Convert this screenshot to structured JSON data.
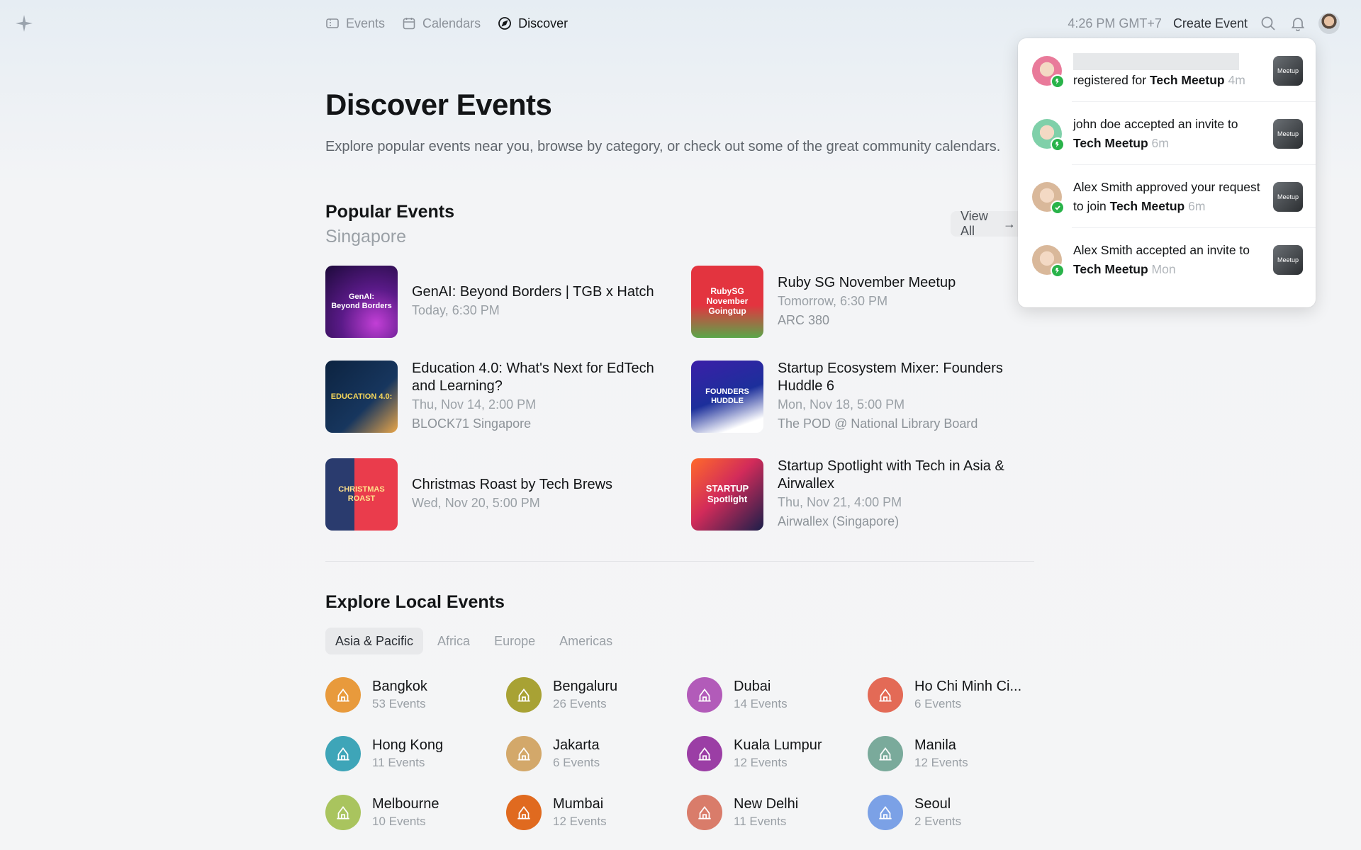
{
  "nav": {
    "items": [
      {
        "label": "Events",
        "icon": "ticket-icon",
        "active": false
      },
      {
        "label": "Calendars",
        "icon": "calendar-icon",
        "active": false
      },
      {
        "label": "Discover",
        "icon": "compass-icon",
        "active": true
      }
    ],
    "time": "4:26 PM GMT+7",
    "create_event": "Create Event"
  },
  "page": {
    "title": "Discover Events",
    "subtitle": "Explore popular events near you, browse by category, or check out some of the great community calendars."
  },
  "popular": {
    "title": "Popular Events",
    "location": "Singapore",
    "view_all": "View All",
    "events": [
      {
        "title": "GenAI: Beyond Borders | TGB x Hatch",
        "title2": "",
        "date": "Today, 6:30 PM",
        "venue": "",
        "thumb_text": "GenAI:\nBeyond Borders"
      },
      {
        "title": "Ruby SG November Meetup",
        "title2": "",
        "date": "Tomorrow, 6:30 PM",
        "venue": "ARC 380",
        "thumb_text": "RubySG November Goingtup"
      },
      {
        "title": "Education 4.0: What's Next for EdTech",
        "title2": "and Learning?",
        "date": "Thu, Nov 14, 2:00 PM",
        "venue": "BLOCK71 Singapore",
        "thumb_text": "EDUCATION 4.0:"
      },
      {
        "title": "Startup Ecosystem Mixer: Founders",
        "title2": "Huddle 6",
        "date": "Mon, Nov 18, 5:00 PM",
        "venue": "The POD @ National Library Board",
        "thumb_text": "FOUNDERS HUDDLE"
      },
      {
        "title": "Christmas Roast by Tech Brews",
        "title2": "",
        "date": "Wed, Nov 20, 5:00 PM",
        "venue": "",
        "thumb_text": "CHRISTMAS ROAST"
      },
      {
        "title": "Startup Spotlight with Tech in Asia &",
        "title2": "Airwallex",
        "date": "Thu, Nov 21, 4:00 PM",
        "venue": "Airwallex (Singapore)",
        "thumb_text": "STARTUP Spotlight"
      }
    ]
  },
  "local": {
    "title": "Explore Local Events",
    "tabs": [
      {
        "label": "Asia & Pacific",
        "active": true
      },
      {
        "label": "Africa",
        "active": false
      },
      {
        "label": "Europe",
        "active": false
      },
      {
        "label": "Americas",
        "active": false
      }
    ],
    "cities": [
      {
        "name": "Bangkok",
        "count": "53 Events",
        "color": "#e89a3c"
      },
      {
        "name": "Bengaluru",
        "count": "26 Events",
        "color": "#a8a234"
      },
      {
        "name": "Dubai",
        "count": "14 Events",
        "color": "#b25bb9"
      },
      {
        "name": "Ho Chi Minh Ci...",
        "count": "6 Events",
        "color": "#e36a56"
      },
      {
        "name": "Hong Kong",
        "count": "11 Events",
        "color": "#3ea5b8"
      },
      {
        "name": "Jakarta",
        "count": "6 Events",
        "color": "#d3a86a"
      },
      {
        "name": "Kuala Lumpur",
        "count": "12 Events",
        "color": "#9b3ea5"
      },
      {
        "name": "Manila",
        "count": "12 Events",
        "color": "#7aaa9b"
      },
      {
        "name": "Melbourne",
        "count": "10 Events",
        "color": "#a9c45e"
      },
      {
        "name": "Mumbai",
        "count": "12 Events",
        "color": "#e06a1f"
      },
      {
        "name": "New Delhi",
        "count": "11 Events",
        "color": "#d97c6a"
      },
      {
        "name": "Seoul",
        "count": "2 Events",
        "color": "#7ba1e6"
      }
    ]
  },
  "notifications": [
    {
      "pre": "",
      "text": "registered for ",
      "bold": "Tech Meetup",
      "time": "4m",
      "avatar_color": "#e97a9a",
      "redacted": true
    },
    {
      "pre": "",
      "text": "john doe accepted an invite to ",
      "bold": "Tech Meetup",
      "time": "6m",
      "avatar_color": "#7fd0a9",
      "redacted": false
    },
    {
      "pre": "",
      "text": "Alex Smith approved your request to join ",
      "bold": "Tech Meetup",
      "time": "6m",
      "avatar_color": "#d9b89a",
      "redacted": false
    },
    {
      "pre": "",
      "text": "Alex Smith accepted an invite to ",
      "bold": "Tech Meetup",
      "time": "Mon",
      "avatar_color": "#d9b89a",
      "redacted": false
    }
  ],
  "meetup_thumb": "Meetup"
}
